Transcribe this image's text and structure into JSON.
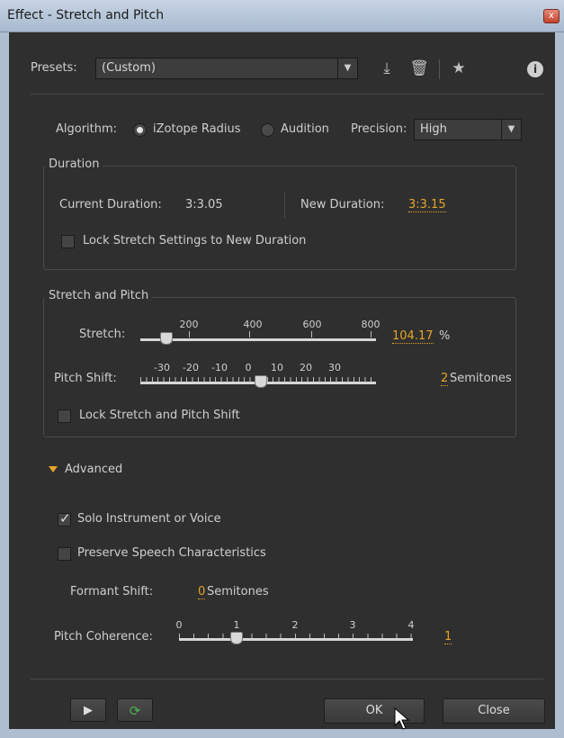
{
  "window": {
    "title": "Effect - Stretch and Pitch",
    "close_glyph": "x"
  },
  "presets": {
    "label": "Presets:",
    "value": "(Custom)"
  },
  "algorithm": {
    "label": "Algorithm:",
    "options": [
      "iZotope Radius",
      "Audition"
    ],
    "selected": "iZotope Radius",
    "precision_label": "Precision:",
    "precision_value": "High"
  },
  "duration": {
    "group_title": "Duration",
    "current_label": "Current Duration:",
    "current_value": "3:3.05",
    "new_label": "New Duration:",
    "new_value": "3:3.15",
    "lock_label": "Lock Stretch Settings to New Duration",
    "lock_checked": false
  },
  "stretch_pitch": {
    "group_title": "Stretch and Pitch",
    "stretch_label": "Stretch:",
    "stretch_ticks": [
      "200",
      "400",
      "600",
      "800"
    ],
    "stretch_value": "104.17",
    "stretch_unit": "%",
    "pitch_label": "Pitch Shift:",
    "pitch_ticks": [
      "-30",
      "-20",
      "-10",
      "0",
      "10",
      "20",
      "30"
    ],
    "pitch_value": "2",
    "pitch_unit": "Semitones",
    "lock_label": "Lock Stretch and Pitch Shift",
    "lock_checked": false
  },
  "advanced": {
    "title": "Advanced",
    "solo_label": "Solo Instrument or Voice",
    "solo_checked": true,
    "preserve_label": "Preserve Speech Characteristics",
    "preserve_checked": false,
    "formant_label": "Formant Shift:",
    "formant_value": "0",
    "formant_unit": "Semitones",
    "coherence_label": "Pitch Coherence:",
    "coherence_ticks": [
      "0",
      "1",
      "2",
      "3",
      "4"
    ],
    "coherence_value": "1"
  },
  "footer": {
    "ok_label": "OK",
    "close_label": "Close"
  },
  "icons": {
    "dropdown": "▼",
    "save_preset": "⤓",
    "delete_preset": "🗑",
    "favorite": "★",
    "info": "i",
    "play": "▶",
    "loop": "⟳"
  },
  "colors": {
    "accent": "#e5a42a",
    "panel": "#2f2f2f"
  }
}
